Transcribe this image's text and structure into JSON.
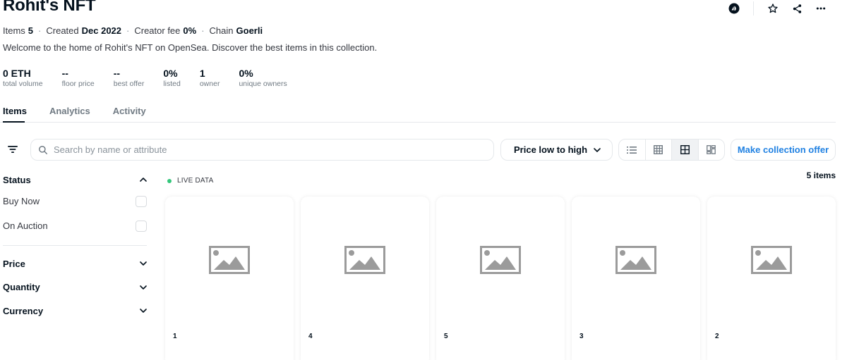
{
  "collection": {
    "title": "Rohit's NFT",
    "meta": {
      "items_label": "Items",
      "items_value": "5",
      "created_label": "Created",
      "created_value": "Dec 2022",
      "fee_label": "Creator fee",
      "fee_value": "0%",
      "chain_label": "Chain",
      "chain_value": "Goerli"
    },
    "description": "Welcome to the home of Rohit's NFT on OpenSea. Discover the best items in this collection."
  },
  "header_actions": [
    {
      "icon": "opensea-pro-icon"
    },
    {
      "icon": "star-icon"
    },
    {
      "icon": "share-icon"
    },
    {
      "icon": "more-icon"
    }
  ],
  "stats": [
    {
      "value": "0 ETH",
      "label": "total volume"
    },
    {
      "value": "--",
      "label": "floor price"
    },
    {
      "value": "--",
      "label": "best offer"
    },
    {
      "value": "0%",
      "label": "listed"
    },
    {
      "value": "1",
      "label": "owner"
    },
    {
      "value": "0%",
      "label": "unique owners"
    }
  ],
  "tabs": [
    {
      "label": "Items",
      "active": true
    },
    {
      "label": "Analytics",
      "active": false
    },
    {
      "label": "Activity",
      "active": false
    }
  ],
  "toolbar": {
    "search_placeholder": "Search by name or attribute",
    "sort_value": "Price low to high",
    "offer_label": "Make collection offer",
    "views": [
      "list-view-icon",
      "large-grid-icon",
      "grid-icon",
      "mosaic-icon"
    ],
    "active_view": 2
  },
  "sidebar": {
    "status": {
      "label": "Status",
      "options": [
        "Buy Now",
        "On Auction"
      ]
    },
    "sections": [
      "Price",
      "Quantity",
      "Currency"
    ]
  },
  "live_label": "LIVE DATA",
  "count_label": "5 items",
  "items": [
    {
      "label": "1"
    },
    {
      "label": "4"
    },
    {
      "label": "5"
    },
    {
      "label": "3"
    },
    {
      "label": "2"
    }
  ],
  "colors": {
    "accent": "#2081e2",
    "live": "#34c77b",
    "text": "#04111d",
    "placeholder_img": "#9b9b9b"
  }
}
